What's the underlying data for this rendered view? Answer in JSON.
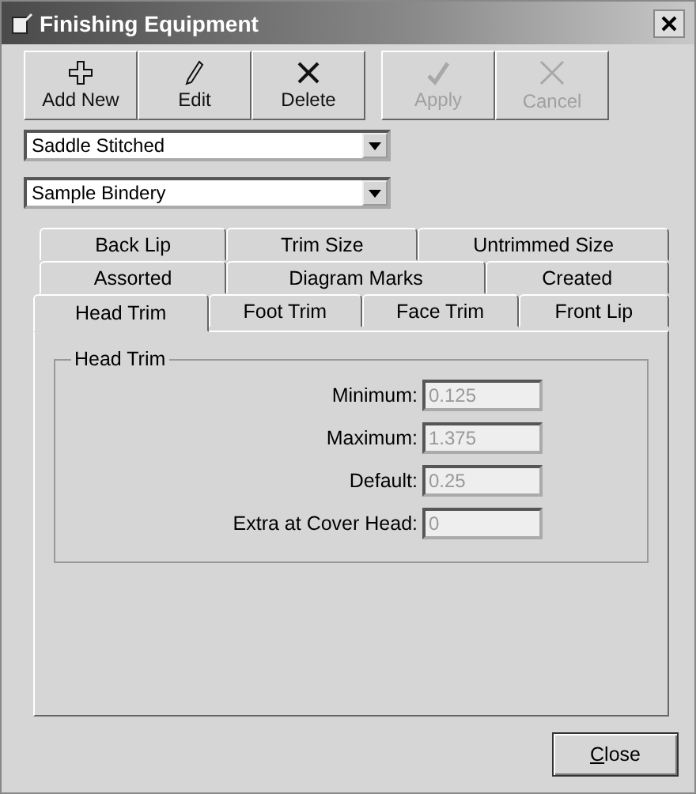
{
  "window": {
    "title": "Finishing Equipment"
  },
  "toolbar": [
    {
      "kind": "add",
      "label": "Add New",
      "disabled": false
    },
    {
      "kind": "edit",
      "label": "Edit",
      "disabled": false
    },
    {
      "kind": "delete",
      "label": "Delete",
      "disabled": false
    },
    {
      "kind": "apply",
      "label": "Apply",
      "disabled": true
    },
    {
      "kind": "cancel",
      "label": "Cancel",
      "disabled": true
    }
  ],
  "dropdowns": [
    {
      "value": "Saddle Stitched"
    },
    {
      "value": "Sample Bindery"
    }
  ],
  "tab_rows": [
    [
      {
        "label": "Back Lip",
        "selected": false
      },
      {
        "label": "Trim Size",
        "selected": false
      },
      {
        "label": "Untrimmed Size",
        "selected": false
      }
    ],
    [
      {
        "label": "Assorted",
        "selected": false
      },
      {
        "label": "Diagram Marks",
        "selected": false
      },
      {
        "label": "Created",
        "selected": false
      }
    ],
    [
      {
        "label": "Head Trim",
        "selected": true
      },
      {
        "label": "Foot Trim",
        "selected": false
      },
      {
        "label": "Face Trim",
        "selected": false
      },
      {
        "label": "Front Lip",
        "selected": false
      }
    ]
  ],
  "group": {
    "title": "Head Trim",
    "fields": [
      {
        "label": "Minimum:",
        "value": "0.125",
        "disabled": true
      },
      {
        "label": "Maximum:",
        "value": "1.375",
        "disabled": true
      },
      {
        "label": "Default:",
        "value": "0.25",
        "disabled": true
      },
      {
        "label": "Extra at Cover Head:",
        "value": "0",
        "disabled": true
      }
    ]
  },
  "close_button": {
    "label": "Close",
    "first_letter_underlined": true
  }
}
